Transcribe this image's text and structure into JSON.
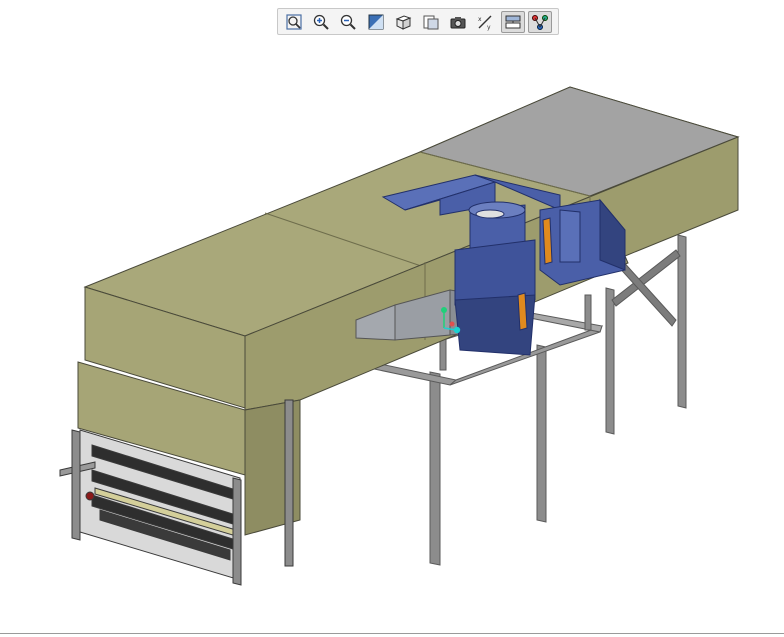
{
  "toolbar": {
    "buttons": [
      {
        "name": "zoom-fit-button",
        "icon": "zoom-fit-icon",
        "active": false
      },
      {
        "name": "zoom-in-button",
        "icon": "zoom-in-icon",
        "active": false
      },
      {
        "name": "zoom-out-button",
        "icon": "zoom-out-icon",
        "active": false
      },
      {
        "name": "shading-button",
        "icon": "shading-icon",
        "active": false
      },
      {
        "name": "view-orientation-button",
        "icon": "cube-view-icon",
        "active": false
      },
      {
        "name": "display-style-button",
        "icon": "display-style-icon",
        "active": false
      },
      {
        "name": "snapshot-button",
        "icon": "camera-icon",
        "active": false
      },
      {
        "name": "measure-button",
        "icon": "measure-icon",
        "active": false
      },
      {
        "name": "section-view-button",
        "icon": "section-view-icon",
        "active": true
      },
      {
        "name": "tree-view-button",
        "icon": "tree-view-icon",
        "active": true
      }
    ]
  },
  "colors": {
    "panel_top": "#a9a87a",
    "panel_side": "#a6a576",
    "panel_shadow": "#8e8d62",
    "roof_grey": "#a3a3a3",
    "fan_blue": "#4a5fa8",
    "fan_blue_dark": "#33447f",
    "steel": "#8c8c8c",
    "steel_dark": "#5a5a5a",
    "duct_grey": "#9a9ea4",
    "accent_orange": "#e08a1e"
  }
}
